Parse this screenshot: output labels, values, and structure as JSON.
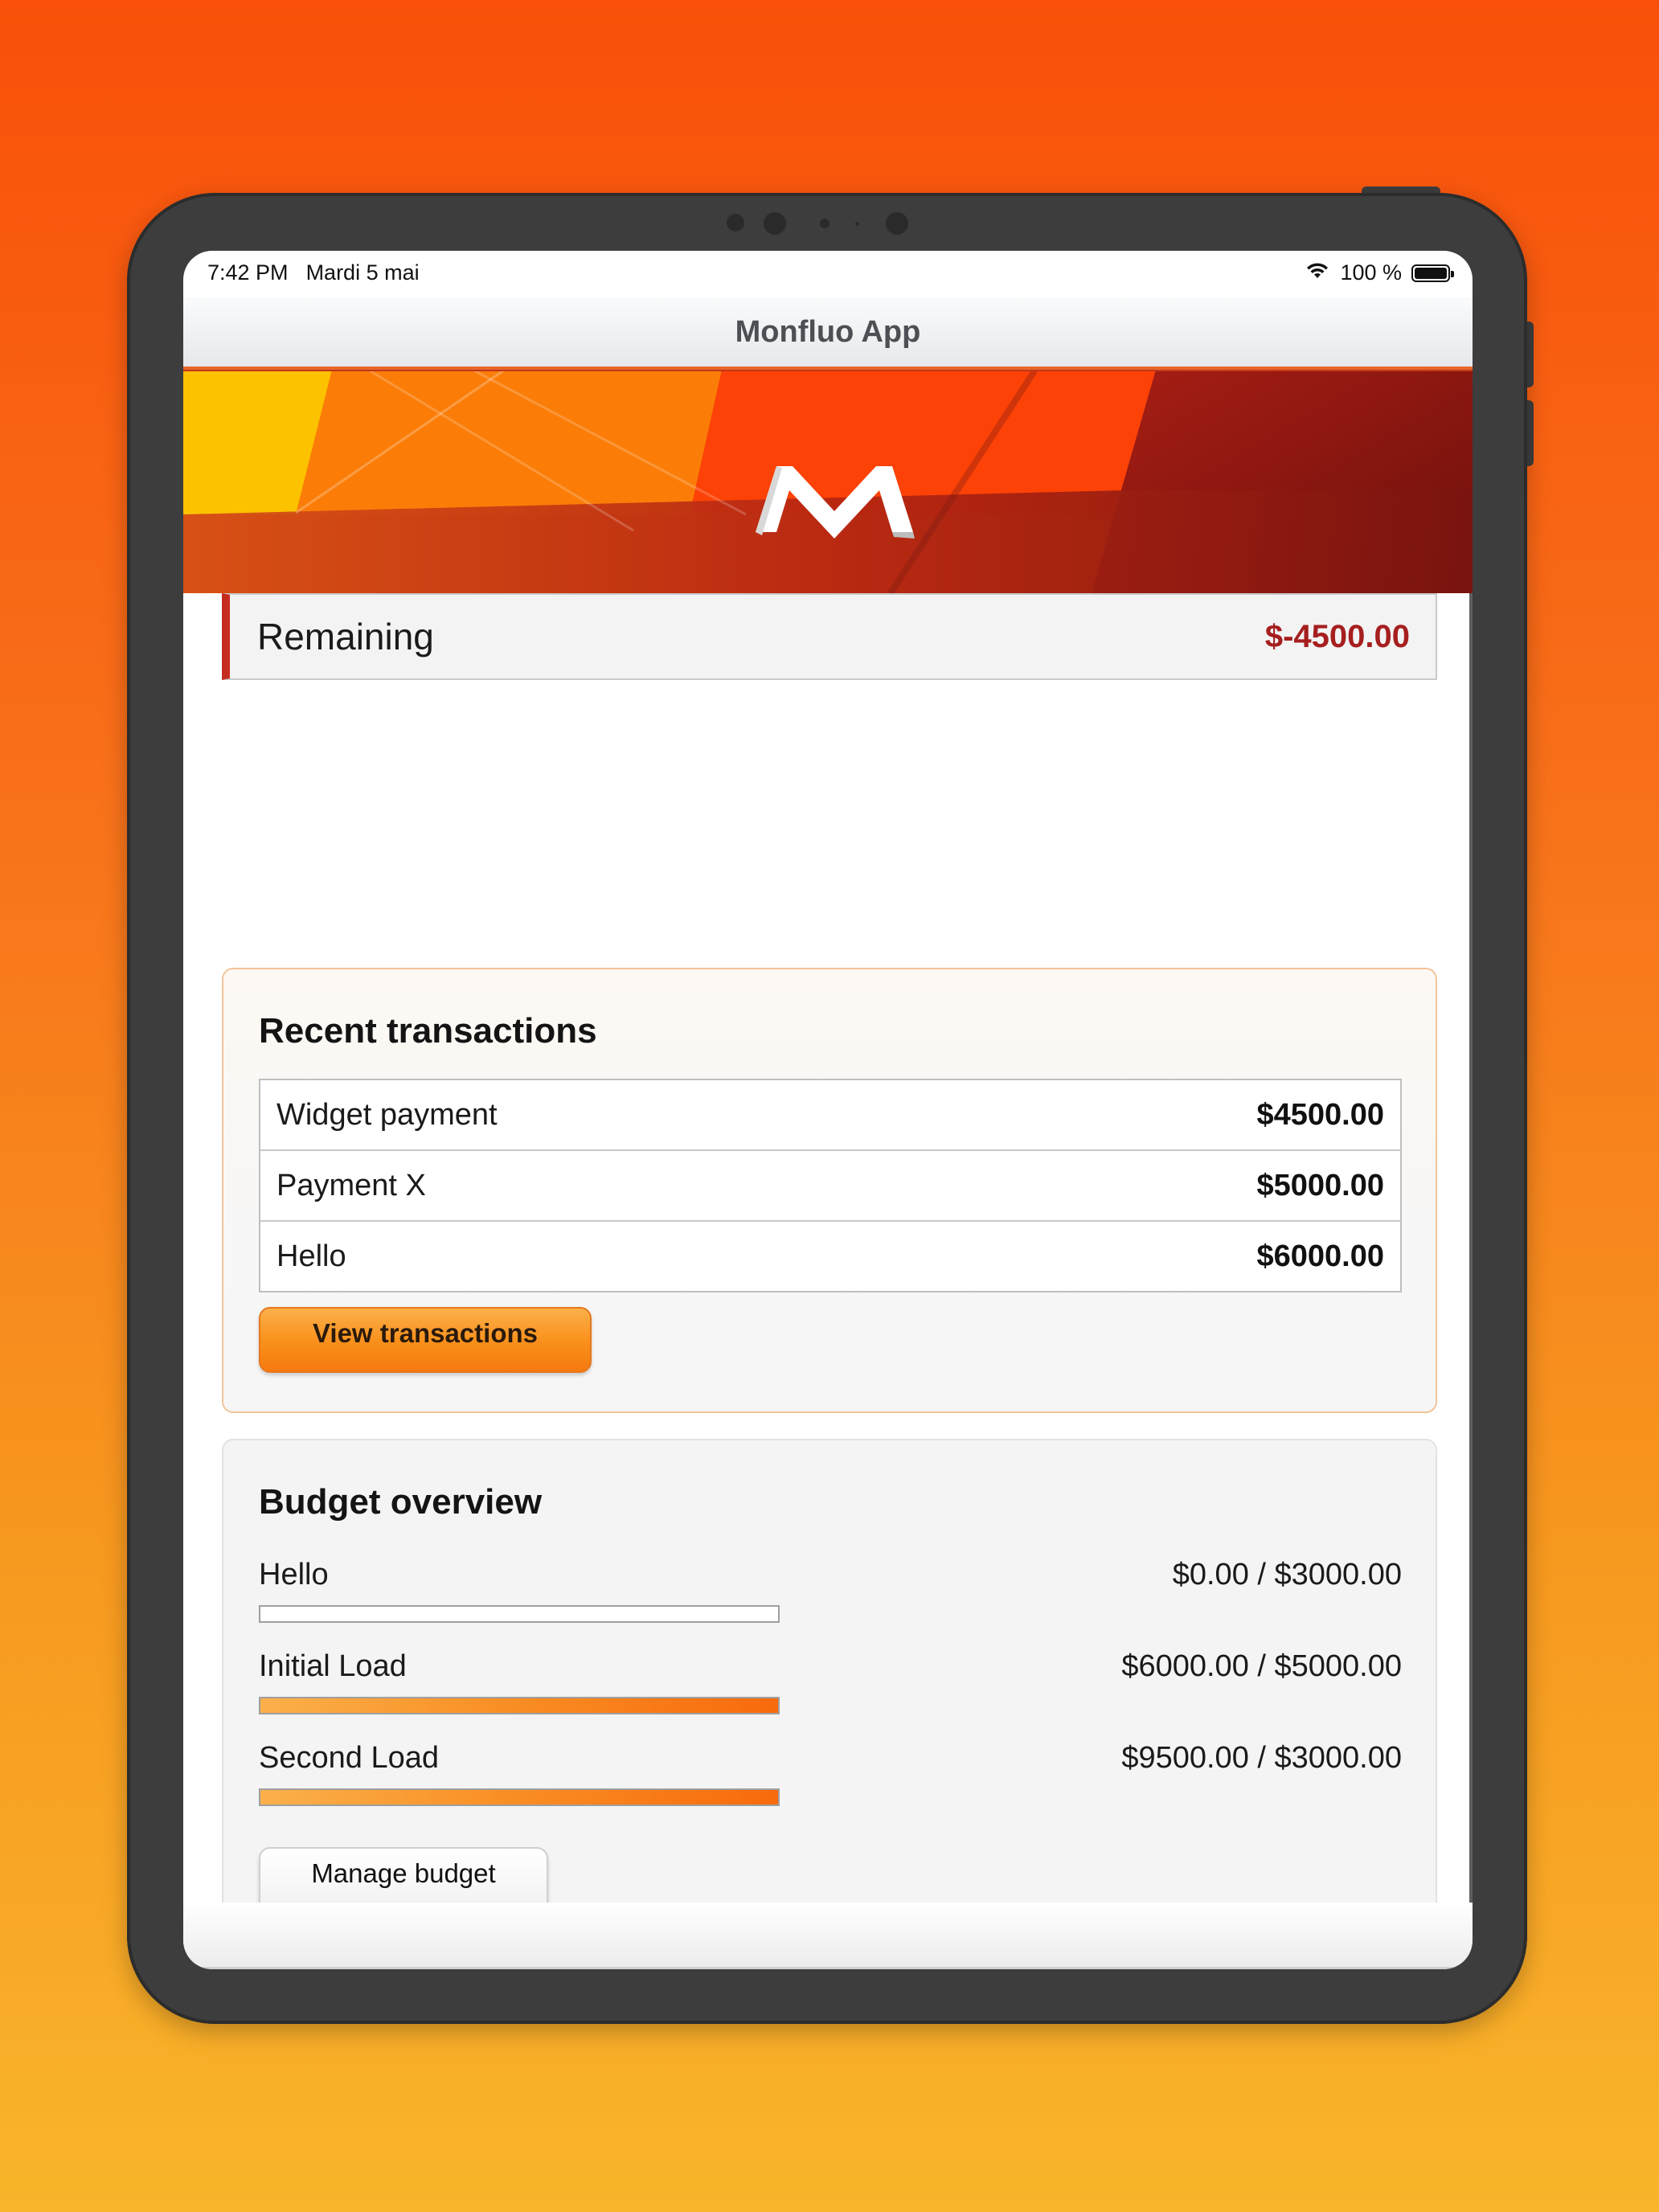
{
  "status_bar": {
    "time": "7:42 PM",
    "date": "Mardi 5 mai",
    "battery_text": "100 %"
  },
  "app": {
    "title": "Monfluo App",
    "logo_letter": "M"
  },
  "remaining": {
    "label": "Remaining",
    "value": "$-4500.00"
  },
  "recent_transactions": {
    "title": "Recent transactions",
    "items": [
      {
        "name": "Widget payment",
        "amount": "$4500.00"
      },
      {
        "name": "Payment X",
        "amount": "$5000.00"
      },
      {
        "name": "Hello",
        "amount": "$6000.00"
      }
    ],
    "button_label": "View transactions"
  },
  "budget_overview": {
    "title": "Budget overview",
    "items": [
      {
        "name": "Hello",
        "amounts": "$0.00 / $3000.00",
        "progress_percent": 0
      },
      {
        "name": "Initial Load",
        "amounts": "$6000.00 / $5000.00",
        "progress_percent": 100
      },
      {
        "name": "Second Load",
        "amounts": "$9500.00 / $3000.00",
        "progress_percent": 100
      }
    ],
    "button_label": "Manage budget"
  },
  "colors": {
    "accent_orange": "#f98f1a",
    "negative_red": "#a61e1e",
    "remaining_border": "#c62b1f"
  }
}
